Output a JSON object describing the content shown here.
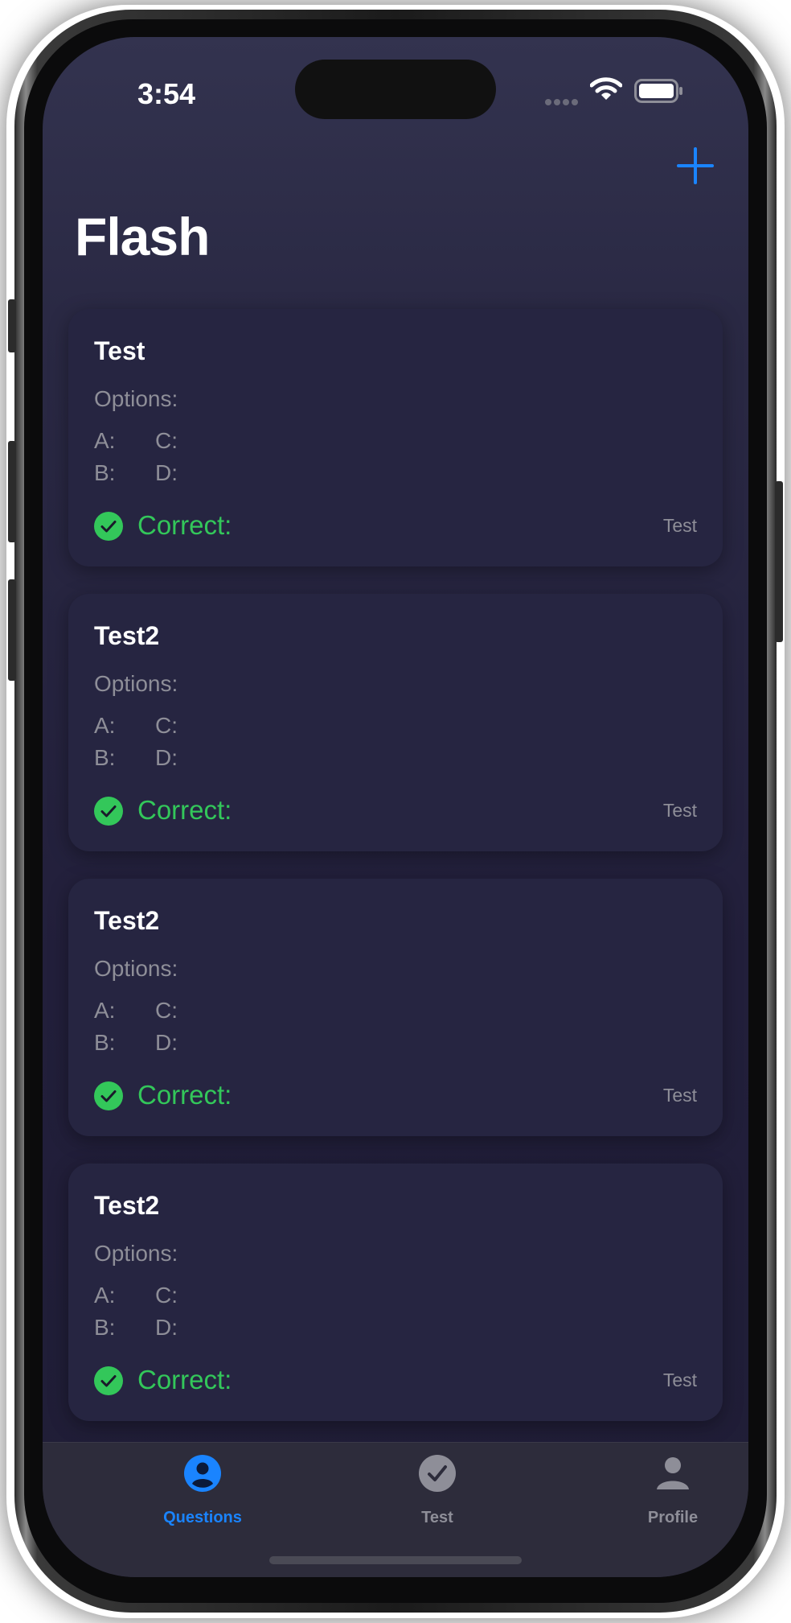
{
  "status_bar": {
    "time": "3:54"
  },
  "header": {
    "title": "Flash",
    "add_icon": "plus-icon"
  },
  "options_label": "Options:",
  "option_letters": {
    "a": "A:",
    "b": "B:",
    "c": "C:",
    "d": "D:"
  },
  "correct_label": "Correct:",
  "cards": [
    {
      "title": "Test",
      "category": "Test"
    },
    {
      "title": "Test2",
      "category": "Test"
    },
    {
      "title": "Test2",
      "category": "Test"
    },
    {
      "title": "Test2",
      "category": "Test"
    }
  ],
  "tabs": [
    {
      "label": "Questions",
      "icon": "person-circle-icon",
      "selected": true
    },
    {
      "label": "Test",
      "icon": "checkmark-circle-icon",
      "selected": false
    },
    {
      "label": "Profile",
      "icon": "person-icon",
      "selected": false
    }
  ],
  "colors": {
    "accent": "#1a84ff",
    "correct": "#33c75a",
    "secondary_text": "#8e8e98",
    "card_background": "#262541",
    "tab_inactive": "#8e8e98"
  }
}
